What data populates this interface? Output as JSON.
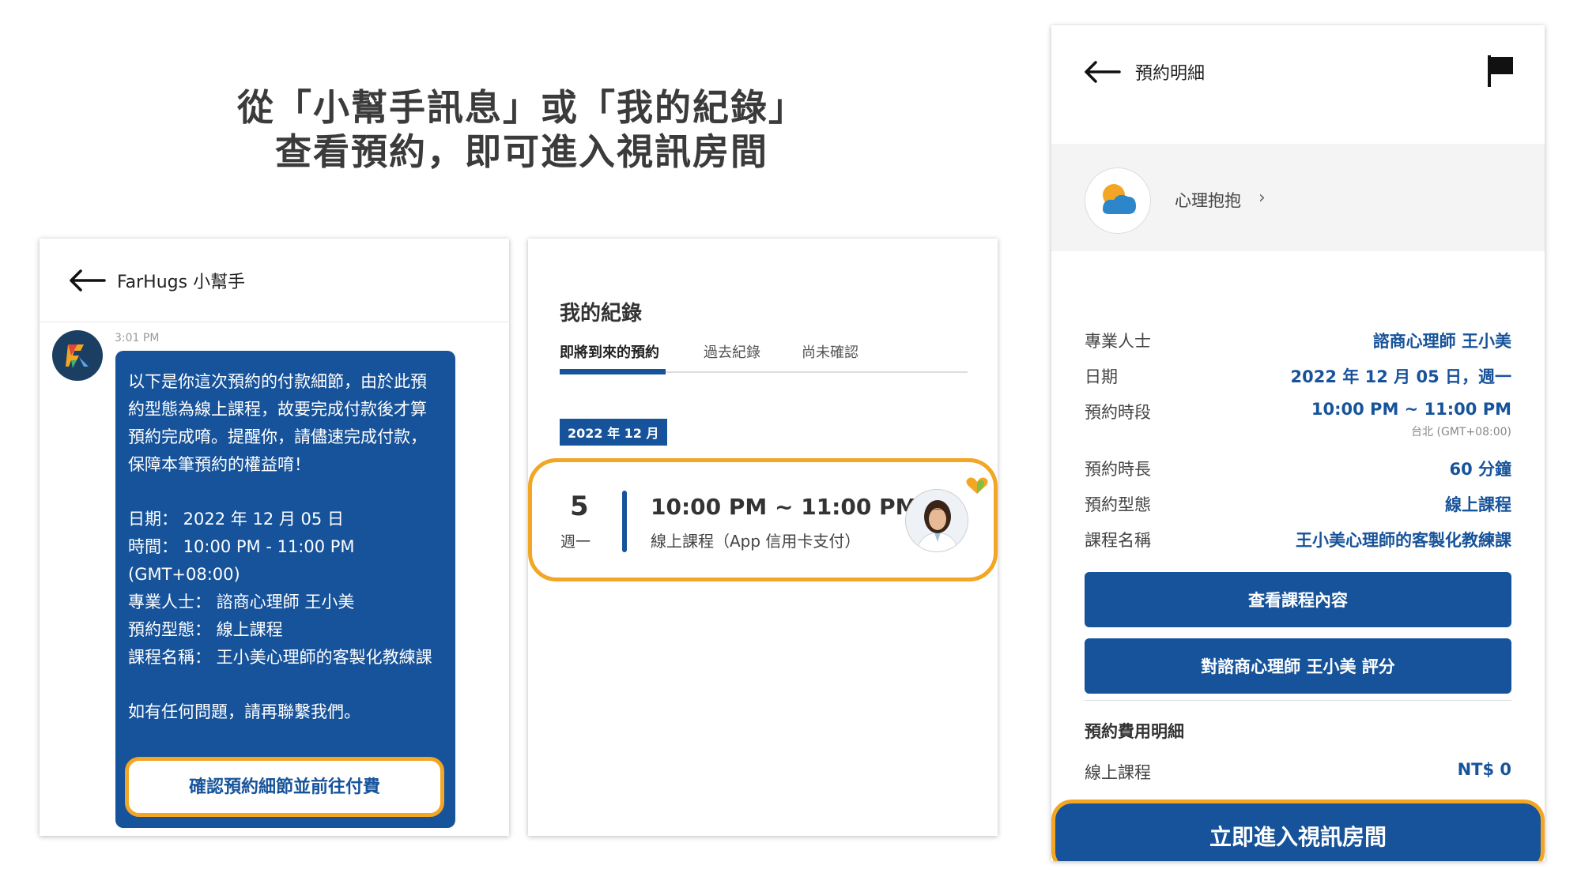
{
  "headline": {
    "line1": "從「小幫手訊息」或「我的紀錄」",
    "line2": "查看預約，即可進入視訊房間"
  },
  "chat": {
    "header_title": "FarHugs 小幫手",
    "time": "3:01 PM",
    "message_intro": "以下是你這次預約的付款細節，由於此預約型態為線上課程，故要完成付款後才算預約完成唷。提醒你，請儘速完成付款，保障本筆預約的權益唷！",
    "message_details": "日期： 2022 年 12 月 05 日\n時間： 10:00 PM - 11:00 PM\n(GMT+08:00)\n專業人士： 諮商心理師 王小美\n預約型態： 線上課程\n課程名稱： 王小美心理師的客製化教練課",
    "message_footer": "如有任何問題，請再聯繫我們。",
    "confirm_button": "確認預約細節並前往付費"
  },
  "records": {
    "title": "我的紀錄",
    "tabs": [
      "即將到來的預約",
      "過去紀錄",
      "尚未確認"
    ],
    "active_tab": "即將到來的預約",
    "month_badge": "2022 年 12 月",
    "appointment": {
      "day": "5",
      "weekday": "週一",
      "time": "10:00 PM ~ 11:00 PM",
      "subtitle": "線上課程（App 信用卡支付）"
    }
  },
  "detail": {
    "header_title": "預約明細",
    "provider_name": "心理抱抱",
    "rows": [
      {
        "label": "專業人士",
        "value": "諮商心理師 王小美"
      },
      {
        "label": "日期",
        "value": "2022 年 12 月 05 日，週一"
      },
      {
        "label": "預約時段",
        "value": "10:00 PM ~ 11:00 PM",
        "note": "台北 (GMT+08:00)"
      },
      {
        "label": "預約時長",
        "value": "60 分鐘"
      },
      {
        "label": "預約型態",
        "value": "線上課程"
      },
      {
        "label": "課程名稱",
        "value": "王小美心理師的客製化教練課"
      }
    ],
    "view_course_button": "查看課程內容",
    "rate_button": "對諮商心理師 王小美 評分",
    "fee_title": "預約費用明細",
    "fee_label": "線上課程",
    "fee_value": "NT$ 0",
    "enter_button": "立即進入視訊房間"
  },
  "colors": {
    "primary": "#17539a",
    "highlight": "#f2a623"
  }
}
